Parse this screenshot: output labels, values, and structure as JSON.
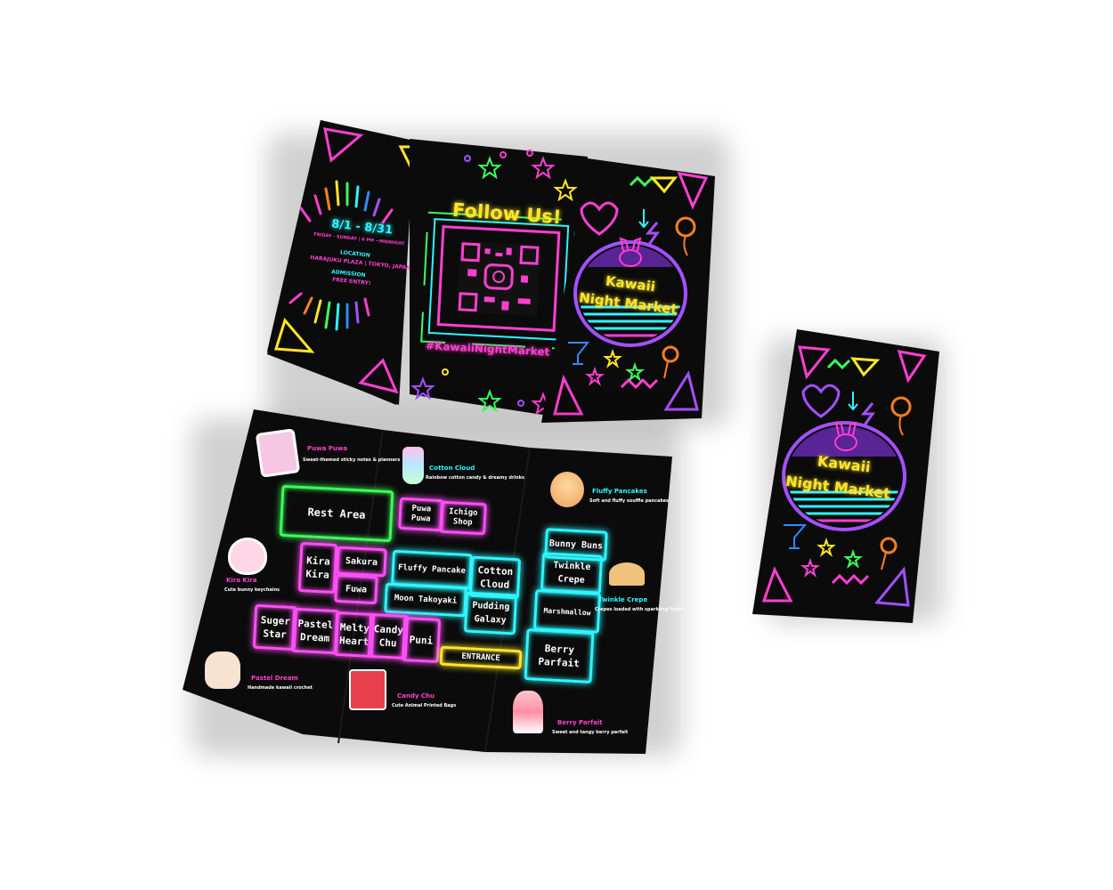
{
  "colors": {
    "neon_pink": "#ff3fd0",
    "neon_cyan": "#2ff6ff",
    "neon_yellow": "#ffe52a",
    "neon_green": "#3dff5a",
    "neon_purple": "#a450ff",
    "paper": "#0b0b0b"
  },
  "brochure_top": {
    "left_panel": {
      "dates": "8/1 - 8/31",
      "hours": "FRIDAY - SUNDAY | 6 PM ~MIDNIGHT",
      "location_label": "LOCATION",
      "location": "HARAJUKU PLAZA | TOKYO, JAPAN",
      "admission_label": "ADMISSION",
      "admission": "FREE ENTRY!"
    },
    "middle_panel": {
      "follow": "Follow Us!",
      "hashtag": "#KawaiiNightMarket"
    },
    "cover": {
      "title_line1": "Kawaii",
      "title_line2": "Night Market"
    }
  },
  "map": {
    "booths": {
      "rest_area": "Rest Area",
      "puwa_puwa": "Puwa\nPuwa",
      "ichigo_shop": "Ichigo\nShop",
      "kira_kira": "Kira\nKira",
      "sakura": "Sakura",
      "fuwa": "Fuwa",
      "fluffy_pancake": "Fluffy Pancake",
      "cotton_cloud": "Cotton\nCloud",
      "moon_takoyaki": "Moon Takoyaki",
      "pudding_galaxy": "Pudding\nGalaxy",
      "bunny_buns": "Bunny Buns",
      "twinkle_crepe": "Twinkle\nCrepe",
      "marshmallow": "Marshmallow",
      "berry_parfait": "Berry\nParfait",
      "sugar_star": "Suger\nStar",
      "pastel_dream": "Pastel\nDream",
      "melty_heart": "Melty\nHeart",
      "candy_chu": "Candy\nChu",
      "puni": "Puni",
      "entrance": "ENTRANCE"
    },
    "callouts": [
      {
        "title": "Puwa Puwa",
        "desc": "Sweet-themed sticky notes & planners"
      },
      {
        "title": "Cotton Cloud",
        "desc": "Rainbow cotton candy & dreamy drinks"
      },
      {
        "title": "Fluffy Pancakes",
        "desc": "Soft and fluffy souffle pancakes"
      },
      {
        "title": "Kira Kira",
        "desc": "Cute bunny keychains"
      },
      {
        "title": "Twinkle Crepe",
        "desc": "Crepes loaded with sparkling fruits"
      },
      {
        "title": "Pastel Dream",
        "desc": "Handmade kawaii crochet"
      },
      {
        "title": "Candy Chu",
        "desc": "Cute Animal Printed Bags"
      },
      {
        "title": "Berry Parfait",
        "desc": "Sweet and tangy berry parfait"
      }
    ]
  },
  "flyer": {
    "title_line1": "Kawaii",
    "title_line2": "Night Market"
  }
}
